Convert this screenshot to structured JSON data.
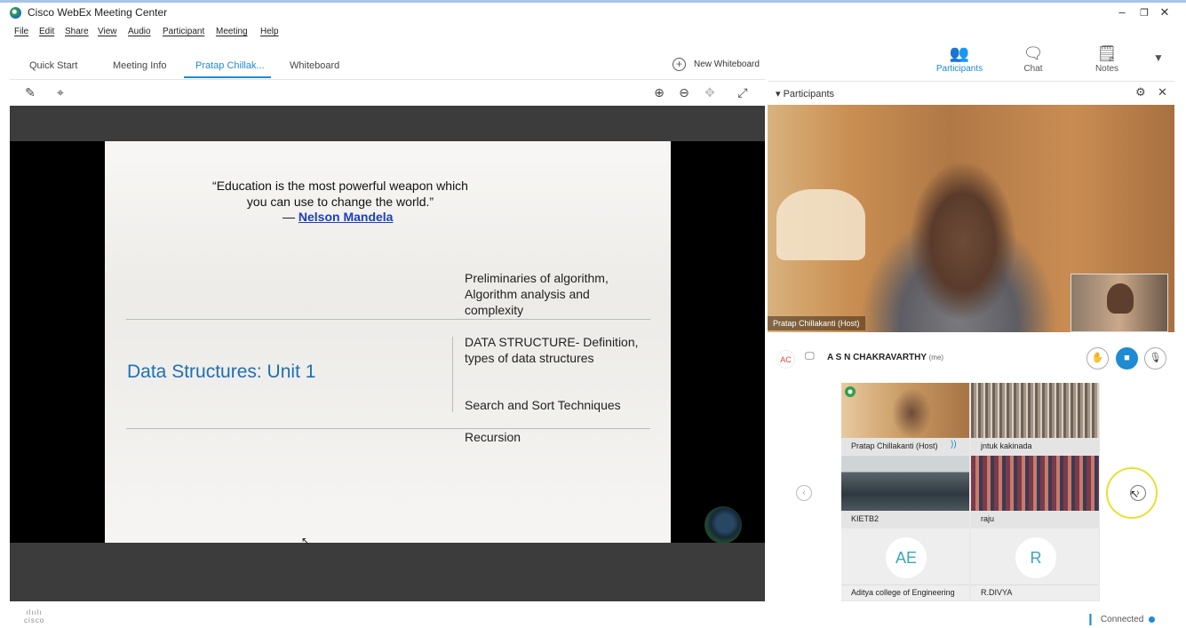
{
  "window": {
    "title": "Cisco WebEx Meeting Center",
    "controls": {
      "minimize": "–",
      "restore": "❐",
      "close": "✕"
    }
  },
  "menu": [
    "File",
    "Edit",
    "Share",
    "View",
    "Audio",
    "Participant",
    "Meeting",
    "Help"
  ],
  "tabs": [
    {
      "label": "Quick Start"
    },
    {
      "label": "Meeting Info"
    },
    {
      "label": "Pratap Chillak...",
      "active": true
    },
    {
      "label": "Whiteboard"
    }
  ],
  "new_whiteboard": {
    "label": "New Whiteboard",
    "icon": "plus-circle-icon"
  },
  "toolbar": {
    "left_icons": [
      "pen-icon",
      "laser-pointer-icon"
    ],
    "right_icons": [
      "zoom-in-icon",
      "zoom-out-icon",
      "move-icon",
      "fullscreen-icon"
    ]
  },
  "slide": {
    "quote_line1": "“Education is the most powerful weapon which",
    "quote_line2": "you can use to change the world.”",
    "quote_dash": "— ",
    "quote_author": "Nelson Mandela",
    "title": "Data Structures: Unit 1",
    "topics": [
      "Preliminaries of algorithm, Algorithm analysis and complexity",
      "DATA STRUCTURE- Definition, types of data structures",
      "Search and Sort Techniques",
      "Recursion"
    ]
  },
  "panel_tabs": [
    {
      "label": "Participants",
      "icon": "participants-icon",
      "active": true
    },
    {
      "label": "Chat",
      "icon": "chat-icon"
    },
    {
      "label": "Notes",
      "icon": "notes-icon"
    }
  ],
  "participants_panel": {
    "header": "Participants",
    "host_video_label": "Pratap Chillakanti (Host)",
    "me": {
      "initials": "AC",
      "name": "A S N CHAKRAVARTHY",
      "tag": "(me)"
    },
    "grid": [
      {
        "name": "Pratap Chillakanti (Host)",
        "has_video": true
      },
      {
        "name": "jntuk kakinada",
        "has_video": true
      },
      {
        "name": "KIETB2",
        "has_video": true
      },
      {
        "name": "raju",
        "has_video": true
      },
      {
        "name": "Aditya college of Engineering",
        "initials": "AE"
      },
      {
        "name": "R.DIVYA",
        "initials": "R"
      }
    ]
  },
  "status": {
    "logo": "cisco",
    "connection": "Connected"
  },
  "colors": {
    "accent": "#1e8bd3",
    "slide_title": "#1f6fb2",
    "highlight": "#e8e030"
  }
}
